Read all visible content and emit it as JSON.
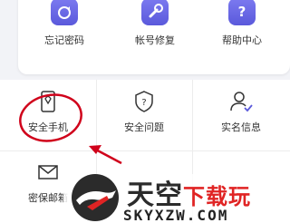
{
  "top_actions": [
    {
      "label": "忘记密码",
      "icon": "lock-refresh-icon"
    },
    {
      "label": "帐号修复",
      "icon": "wrench-icon"
    },
    {
      "label": "帮助中心",
      "icon": "question-icon"
    }
  ],
  "security_grid": [
    {
      "label": "安全手机",
      "icon": "phone-icon"
    },
    {
      "label": "安全问题",
      "icon": "shield-question-icon"
    },
    {
      "label": "实名信息",
      "icon": "user-check-icon"
    },
    {
      "label": "密保邮箱",
      "icon": "mail-icon"
    }
  ],
  "annotation": {
    "highlight_color": "#d0021b"
  },
  "watermark": {
    "title_main": "天空",
    "title_accent": "下载玩",
    "url": "SKYXZW.COM"
  },
  "colors": {
    "accent": "#5a59db",
    "background": "#f2f3f7",
    "watermark_red": "#e02424"
  }
}
